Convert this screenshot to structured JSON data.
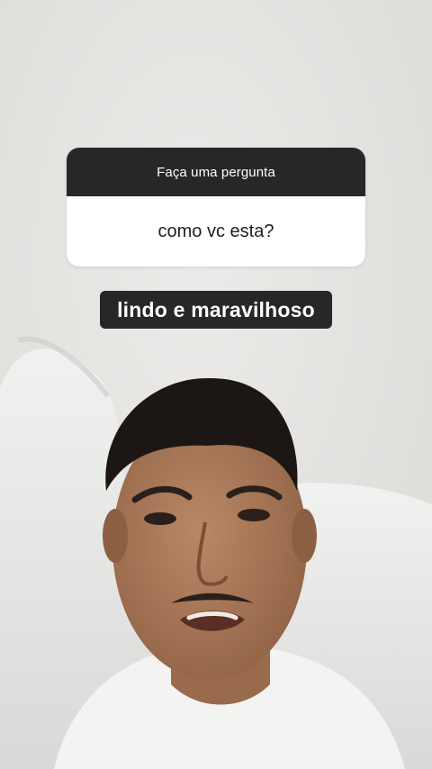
{
  "question_sticker": {
    "header": "Faça uma pergunta",
    "question": "como vc esta?"
  },
  "answer_caption": "lindo e maravilhoso",
  "colors": {
    "background": "#e7e6e4",
    "sticker_header": "#262729",
    "caption_bg": "#262729",
    "text_light": "#ffffff",
    "text_dark": "#1e1e1e"
  }
}
